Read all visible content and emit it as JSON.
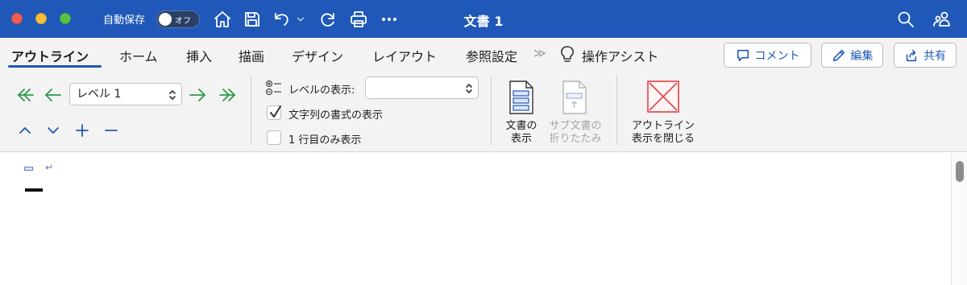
{
  "window": {
    "title": "文書 1",
    "autosave_label": "自動保存",
    "autosave_state": "オフ"
  },
  "tabs": [
    {
      "label": "アウトライン",
      "active": true
    },
    {
      "label": "ホーム"
    },
    {
      "label": "挿入"
    },
    {
      "label": "描画"
    },
    {
      "label": "デザイン"
    },
    {
      "label": "レイアウト"
    },
    {
      "label": "参照設定"
    }
  ],
  "overflow_chevron": "≫",
  "tell_me": "操作アシスト",
  "top_right": {
    "comment_label": "コメント",
    "edit_label": "編集",
    "share_label": "共有"
  },
  "ribbon": {
    "outline_level_value": "レベル 1",
    "show_level_label": "レベルの表示:",
    "show_level_value": "",
    "show_text_formatting_label": "文字列の書式の表示",
    "show_text_formatting_checked": true,
    "first_line_only_label": "1 行目のみ表示",
    "first_line_only_checked": false,
    "show_document_label": "文書の\n表示",
    "collapse_subdocs_label": "サブ文書の\n折りたたみ",
    "close_outline_label": "アウトライン\n表示を閉じる"
  },
  "colors": {
    "titlebar": "#1f58b8",
    "accent": "#1f58b8",
    "promote_demote": "#2e9a4a",
    "close_red": "#e0404a"
  },
  "icons": [
    "home-icon",
    "save-icon",
    "undo-icon",
    "redo-icon",
    "print-icon",
    "more-icon",
    "search-icon",
    "people-icon",
    "lightbulb-icon",
    "comment-icon",
    "pencil-icon",
    "share-icon"
  ]
}
